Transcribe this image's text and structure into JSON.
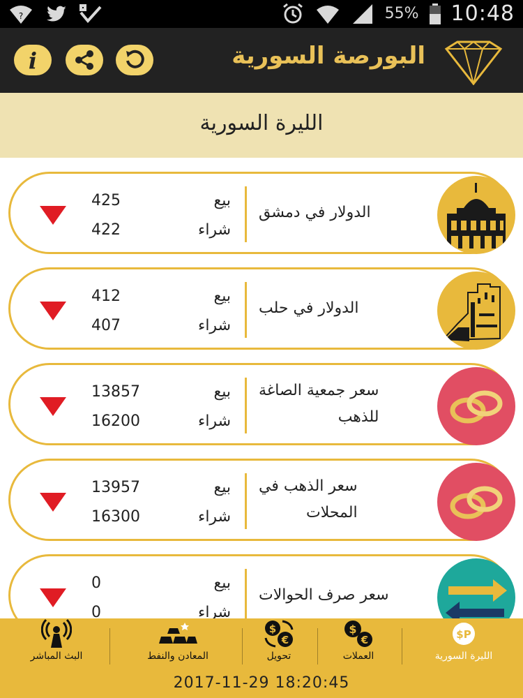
{
  "status_bar": {
    "battery": "55%",
    "time": "10:48",
    "left_icons": [
      "wifi-question-icon",
      "twitter-icon",
      "tasks-check-icon"
    ],
    "right_icons": [
      "alarm-icon",
      "wifi-icon",
      "signal-icon",
      "battery-icon"
    ]
  },
  "app_bar": {
    "title": "البورصة السورية",
    "icons": [
      "info-icon",
      "share-icon",
      "refresh-icon",
      "diamond-logo-icon"
    ]
  },
  "section": {
    "title": "الليرة السورية"
  },
  "rates": [
    {
      "name_line1": "الدولار في دمشق",
      "name_line2": "",
      "sell_label": "بيع",
      "buy_label": "شراء",
      "sell": "425",
      "buy": "422",
      "thumb": "damascus-mosque-icon",
      "trend": "down"
    },
    {
      "name_line1": "الدولار في حلب",
      "name_line2": "",
      "sell_label": "بيع",
      "buy_label": "شراء",
      "sell": "412",
      "buy": "407",
      "thumb": "aleppo-citadel-icon",
      "trend": "down"
    },
    {
      "name_line1": "سعر جمعية الصاغة",
      "name_line2": "للذهب",
      "sell_label": "بيع",
      "buy_label": "شراء",
      "sell": "13857",
      "buy": "16200",
      "thumb": "gold-rings-icon",
      "trend": "down"
    },
    {
      "name_line1": "سعر الذهب في",
      "name_line2": "المحلات",
      "sell_label": "بيع",
      "buy_label": "شراء",
      "sell": "13957",
      "buy": "16300",
      "thumb": "gold-rings-icon",
      "trend": "down"
    },
    {
      "name_line1": "سعر صرف الحوالات",
      "name_line2": "",
      "sell_label": "بيع",
      "buy_label": "شراء",
      "sell": "0",
      "buy": "0",
      "thumb": "transfer-arrows-icon",
      "trend": "down"
    }
  ],
  "tabs": [
    {
      "label": "الليرة السورية",
      "icon": "syrian-pound-icon",
      "active": true
    },
    {
      "label": "العملات",
      "icon": "currencies-icon",
      "active": false
    },
    {
      "label": "تحويل",
      "icon": "exchange-icon",
      "active": false
    },
    {
      "label": "المعادن والنفط",
      "icon": "gold-bars-icon",
      "active": false
    },
    {
      "label": "البث المباشر",
      "icon": "broadcast-icon",
      "active": false
    }
  ],
  "datetime": "2017-11-29 18:20:45",
  "colors": {
    "accent": "#e8b93c",
    "header_bg": "#222222",
    "section_bg": "#efe2b2",
    "trend_down": "#e01c24",
    "rings_bg": "#e14e63",
    "transfer_bg": "#1ea89b"
  }
}
